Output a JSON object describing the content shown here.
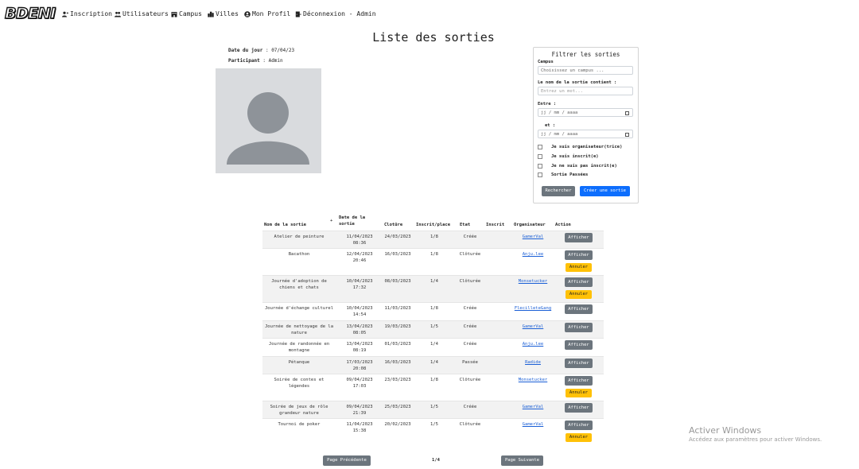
{
  "nav": {
    "logo": "BDENI",
    "items": [
      {
        "label": "Inscription",
        "icon": "user-plus-icon"
      },
      {
        "label": "Utilisateurs",
        "icon": "users-icon"
      },
      {
        "label": "Campus",
        "icon": "building-icon"
      },
      {
        "label": "Villes",
        "icon": "city-icon"
      },
      {
        "label": "Mon Profil",
        "icon": "user-circle-icon"
      },
      {
        "label": "Déconnexion - Admin",
        "icon": "logout-icon"
      }
    ]
  },
  "page": {
    "title": "Liste des sorties",
    "date_label": "Date du jour",
    "date_value": " : 07/04/23",
    "participant_label": "Participant",
    "participant_value": " : Admin"
  },
  "filter": {
    "title": "Filtrer les sorties",
    "campus_label": "Campus",
    "campus_placeholder": "Choisissez un campus ...",
    "name_label": "Le nom de la sortie contient :",
    "name_placeholder": "Entrez un mot...",
    "between_label": "Entre :",
    "date_placeholder": "jj / mm / aaaa",
    "and_label": "et :",
    "checkboxes": [
      "Je suis organisateur(trice)",
      "Je suis inscrit(e)",
      "Je ne suis pas inscrit(e)",
      "Sortie Passées"
    ],
    "search_button": "Rechercher",
    "create_button": "Créer une sortie"
  },
  "table": {
    "headers": {
      "name": "Nom de la sortie",
      "date_line1": "Date de la",
      "date_line2": "sortie",
      "closing": "Clotûre",
      "registered": "Inscrit/place",
      "state": "Etat",
      "enrolled": "Inscrit",
      "organizer": "Organisateur",
      "action": "Action"
    },
    "show_label": "Afficher",
    "cancel_label": "Annuler",
    "rows": [
      {
        "name": [
          "Atelier de peinture"
        ],
        "date": [
          "11/04/2023",
          "08:36"
        ],
        "closing": "24/03/2023",
        "places": "1/8",
        "state": "Créée",
        "organizer": "GamerVal",
        "cancel": false
      },
      {
        "name": [
          "Bacathon"
        ],
        "date": [
          "12/04/2023",
          "20:46"
        ],
        "closing": "16/03/2023",
        "places": "1/8",
        "state": "Clôturée",
        "organizer": "Anju.lee",
        "cancel": true
      },
      {
        "name": [
          "Journée d'adoption de",
          "chiens et chats"
        ],
        "date": [
          "10/04/2023",
          "17:32"
        ],
        "closing": "08/03/2023",
        "places": "1/4",
        "state": "Clôturée",
        "organizer": "Monsetucker",
        "cancel": true
      },
      {
        "name": [
          "Journée d'échange culturel"
        ],
        "date": [
          "10/04/2023",
          "14:54"
        ],
        "closing": "11/03/2023",
        "places": "1/8",
        "state": "Créée",
        "organizer": "FlecilleteGang",
        "cancel": false
      },
      {
        "name": [
          "Journée de nettoyage de la",
          "nature"
        ],
        "date": [
          "13/04/2023",
          "08:05"
        ],
        "closing": "19/03/2023",
        "places": "1/5",
        "state": "Créée",
        "organizer": "GamerVal",
        "cancel": false
      },
      {
        "name": [
          "Journée de randonnée en",
          "montagne"
        ],
        "date": [
          "13/04/2023",
          "08:19"
        ],
        "closing": "01/03/2023",
        "places": "1/4",
        "state": "Créée",
        "organizer": "Anju.lee",
        "cancel": false
      },
      {
        "name": [
          "Pétanque"
        ],
        "date": [
          "17/03/2023",
          "20:08"
        ],
        "closing": "16/03/2023",
        "places": "1/4",
        "state": "Passée",
        "organizer": "Radide",
        "cancel": false
      },
      {
        "name": [
          "Soirée de contes et",
          "légendes"
        ],
        "date": [
          "09/04/2023",
          "17:03"
        ],
        "closing": "23/03/2023",
        "places": "1/8",
        "state": "Clôturée",
        "organizer": "Monsetucker",
        "cancel": true
      },
      {
        "name": [
          "Soirée de jeux de rôle",
          "grandeur nature"
        ],
        "date": [
          "09/04/2023",
          "21:39"
        ],
        "closing": "25/03/2023",
        "places": "1/5",
        "state": "Créée",
        "organizer": "GamerVal",
        "cancel": false
      },
      {
        "name": [
          "Tournoi de poker"
        ],
        "date": [
          "11/04/2023",
          "15:38"
        ],
        "closing": "20/02/2023",
        "places": "1/5",
        "state": "Clôturée",
        "organizer": "GamerVal",
        "cancel": true
      }
    ]
  },
  "pager": {
    "prev": "Page Précédente",
    "page": "1/4",
    "next": "Page Suivante"
  },
  "watermark": {
    "title": "Activer Windows",
    "subtitle": "Accédez aux paramètres pour activer Windows."
  }
}
